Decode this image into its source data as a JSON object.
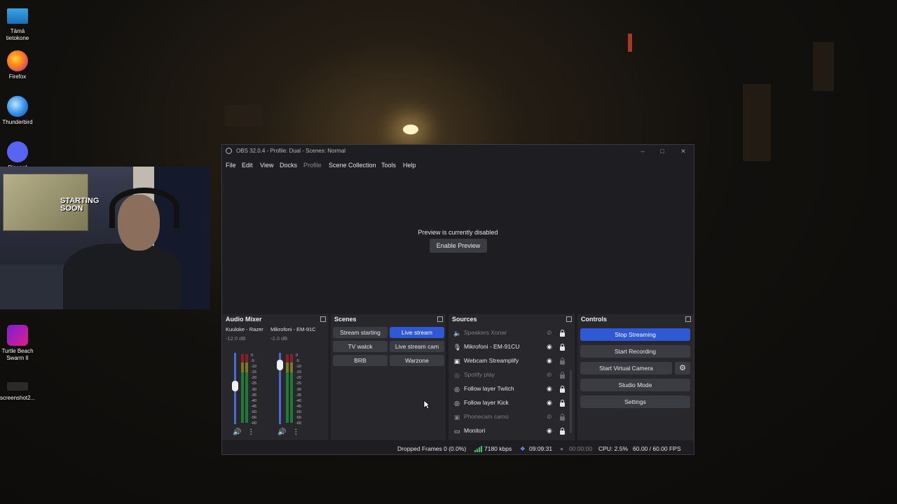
{
  "desktop": {
    "icons": [
      {
        "label": "Tämä\ntietokone",
        "icon": "computer-icon"
      },
      {
        "label": "Firefox",
        "icon": "firefox-icon"
      },
      {
        "label": "Thunderbird",
        "icon": "thunderbird-icon"
      },
      {
        "label": "Discord",
        "icon": "discord-icon"
      },
      {
        "label": "Turtle Beach\nSwarm II",
        "icon": "turtle-beach-icon"
      },
      {
        "label": "screenshot2...",
        "icon": "image-file-icon"
      }
    ],
    "webcam": {
      "poster_text": "STARTING SOON"
    }
  },
  "obs": {
    "title": "OBS 32.0.4 - Profile: Dual - Scenes: Normal",
    "menu": [
      "File",
      "Edit",
      "View",
      "Docks",
      "Profile",
      "Scene Collection",
      "Tools",
      "Help"
    ],
    "preview": {
      "message": "Preview is currently disabled",
      "button": "Enable Preview"
    },
    "audio_mixer": {
      "title": "Audio Mixer",
      "channels": [
        {
          "name": "Kuuloke - Razer",
          "db": "-12.0 dB",
          "level": -12.0
        },
        {
          "name": "Mikrofoni - EM-91C",
          "db": "-2.0 dB",
          "level": -2.0
        }
      ],
      "ticks": [
        "0",
        "-5",
        "-10",
        "-15",
        "-20",
        "-25",
        "-30",
        "-35",
        "-40",
        "-45",
        "-50",
        "-56",
        "-60"
      ]
    },
    "scenes": {
      "title": "Scenes",
      "items": [
        "Stream starting",
        "Live stream",
        "TV watck",
        "Live stream cam",
        "BRB",
        "Warzone"
      ],
      "active": "Live stream"
    },
    "sources": {
      "title": "Sources",
      "items": [
        {
          "name": "Speakers Xonar",
          "icon": "speaker-icon",
          "visible": false,
          "locked": true
        },
        {
          "name": "Mikrofoni - EM-91CU",
          "icon": "microphone-icon",
          "visible": true,
          "locked": true
        },
        {
          "name": "Webcam Streamplify",
          "icon": "camera-icon",
          "visible": true,
          "locked": false
        },
        {
          "name": "Spotify play",
          "icon": "browser-icon",
          "visible": false,
          "locked": false
        },
        {
          "name": "Follow layer Twitch",
          "icon": "browser-icon",
          "visible": true,
          "locked": true
        },
        {
          "name": "Follow layer Kick",
          "icon": "browser-icon",
          "visible": true,
          "locked": true
        },
        {
          "name": "Phonecam camo",
          "icon": "camera-icon",
          "visible": false,
          "locked": false
        },
        {
          "name": "Monitori",
          "icon": "monitor-icon",
          "visible": true,
          "locked": true
        }
      ]
    },
    "controls": {
      "title": "Controls",
      "buttons": [
        "Stop Streaming",
        "Start Recording",
        "Start Virtual Camera",
        "Studio Mode",
        "Settings"
      ]
    },
    "status": {
      "dropped": "Dropped Frames 0 (0.0%)",
      "bitrate": "7180 kbps",
      "stream_time": "09:09:31",
      "record_time": "00:00:00",
      "cpu": "CPU: 2.5%",
      "fps": "60.00 / 60.00 FPS"
    },
    "colors": {
      "accent": "#2f58d6",
      "panel": "#27272c",
      "window": "#1e1e22",
      "status_green": "#39c46a"
    }
  }
}
